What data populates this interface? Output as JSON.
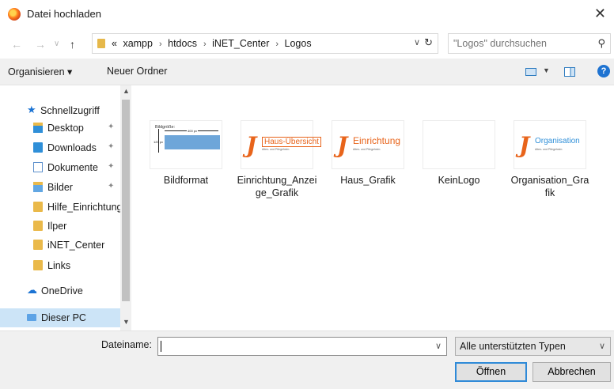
{
  "window": {
    "title": "Datei hochladen",
    "close": "✕"
  },
  "address": {
    "overflow": "«",
    "crumbs": [
      "xampp",
      "htdocs",
      "iNET_Center",
      "Logos"
    ],
    "separator": "›",
    "search_placeholder": "\"Logos\" durchsuchen"
  },
  "toolbar": {
    "organize": "Organisieren ▾",
    "new_folder": "Neuer Ordner",
    "help": "?"
  },
  "sidebar": {
    "items": [
      {
        "label": "Schnellzugriff",
        "icon": "star-icon"
      },
      {
        "label": "Desktop",
        "icon": "desktop-icon",
        "pinned": true
      },
      {
        "label": "Downloads",
        "icon": "download-icon",
        "pinned": true
      },
      {
        "label": "Dokumente",
        "icon": "documents-icon",
        "pinned": true
      },
      {
        "label": "Bilder",
        "icon": "pictures-icon",
        "pinned": true
      },
      {
        "label": "Hilfe_Einrichtung",
        "icon": "folder-icon"
      },
      {
        "label": "Ilper",
        "icon": "folder-icon"
      },
      {
        "label": "iNET_Center",
        "icon": "folder-icon"
      },
      {
        "label": "Links",
        "icon": "folder-icon"
      },
      {
        "label": "OneDrive",
        "icon": "cloud-icon"
      },
      {
        "label": "Dieser PC",
        "icon": "computer-icon",
        "selected": true
      }
    ]
  },
  "files": [
    {
      "name": "Bildformat",
      "thumb": {
        "heading": "Bildgröße:",
        "width_text": "400 px",
        "height_text": "120 px"
      }
    },
    {
      "name": "Einrichtung_Anzeige_Grafik",
      "thumb": {
        "logo_text": "Haus-Übersicht",
        "sub": "Alten- und Pflegeheim"
      }
    },
    {
      "name": "Haus_Grafik",
      "thumb": {
        "logo_text": "Einrichtung",
        "sub": "Alten- und Pflegeheim"
      }
    },
    {
      "name": "KeinLogo"
    },
    {
      "name": "Organisation_Grafik",
      "thumb": {
        "logo_text": "Organisation",
        "sub": "Alten- und Pflegeheim"
      }
    }
  ],
  "footer": {
    "filename_label": "Dateiname:",
    "filename_value": "",
    "file_type": "Alle unterstützten Typen",
    "open": "Öffnen",
    "cancel": "Abbrechen"
  },
  "colors": {
    "accent": "#1e73d1",
    "selection": "#cce4f7",
    "logo_orange": "#e8641b",
    "folder": "#eab94a"
  }
}
